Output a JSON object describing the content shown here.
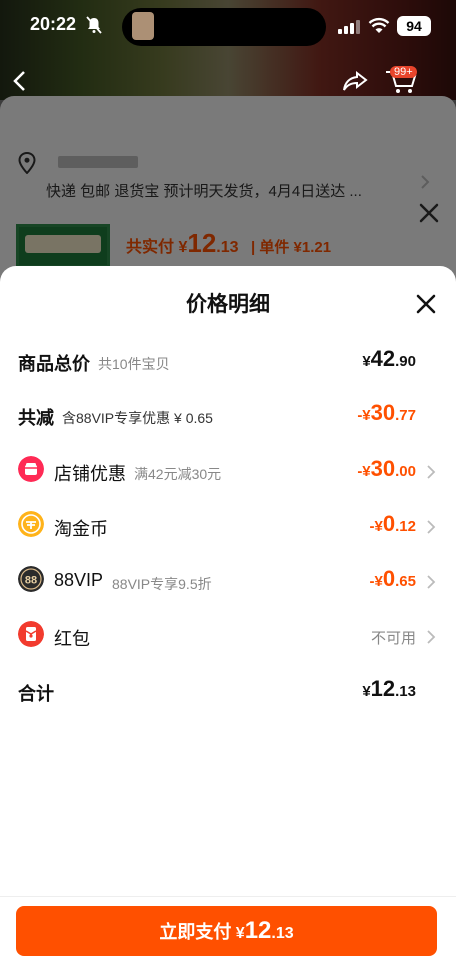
{
  "status_bar": {
    "time": "20:22",
    "battery": "94"
  },
  "background": {
    "cart_badge": "99+",
    "shipping_info": "快递 包邮 退货宝 预计明天发货，4月4日送达 ...",
    "summary_label": "共实付",
    "summary_symbol": "¥",
    "summary_int": "12",
    "summary_dec": ".13",
    "unit_price": "| 单件 ¥1.21"
  },
  "sheet": {
    "title": "价格明细",
    "rows": {
      "total": {
        "label": "商品总价",
        "sub": "共10件宝贝",
        "symbol": "¥",
        "int": "42",
        "dec": ".90"
      },
      "reduced": {
        "label": "共减",
        "sub": "含88VIP专享优惠 ¥ 0.65",
        "symbol": "-¥",
        "int": "30",
        "dec": ".77"
      },
      "store": {
        "label": "店铺优惠",
        "sub": "满42元减30元",
        "symbol": "-¥",
        "int": "30",
        "dec": ".00"
      },
      "coin": {
        "label": "淘金币",
        "sub": "",
        "symbol": "-¥",
        "int": "0",
        "dec": ".12"
      },
      "vip": {
        "label": "88VIP",
        "sub": "88VIP专享9.5折",
        "symbol": "-¥",
        "int": "0",
        "dec": ".65"
      },
      "redpacket": {
        "label": "红包",
        "status": "不可用"
      },
      "sum": {
        "label": "合计",
        "symbol": "¥",
        "int": "12",
        "dec": ".13"
      }
    },
    "pay_button": {
      "label": "立即支付",
      "symbol": "¥",
      "int": "12",
      "dec": ".13"
    }
  },
  "colors": {
    "accent": "#ff5000",
    "store_icon": "#ff2a55",
    "coin_icon": "#ffb31a",
    "vip_icon": "#2b2b2b",
    "redpacket_icon": "#f23b2e"
  },
  "icons": [
    "bell-muted-icon",
    "signal-icon",
    "wifi-icon",
    "back-arrow-icon",
    "share-icon",
    "cart-icon",
    "close-icon",
    "location-pin-icon",
    "chevron-right-icon",
    "store-coupon-icon",
    "taojinbi-coin-icon",
    "vip88-icon",
    "red-packet-icon"
  ]
}
